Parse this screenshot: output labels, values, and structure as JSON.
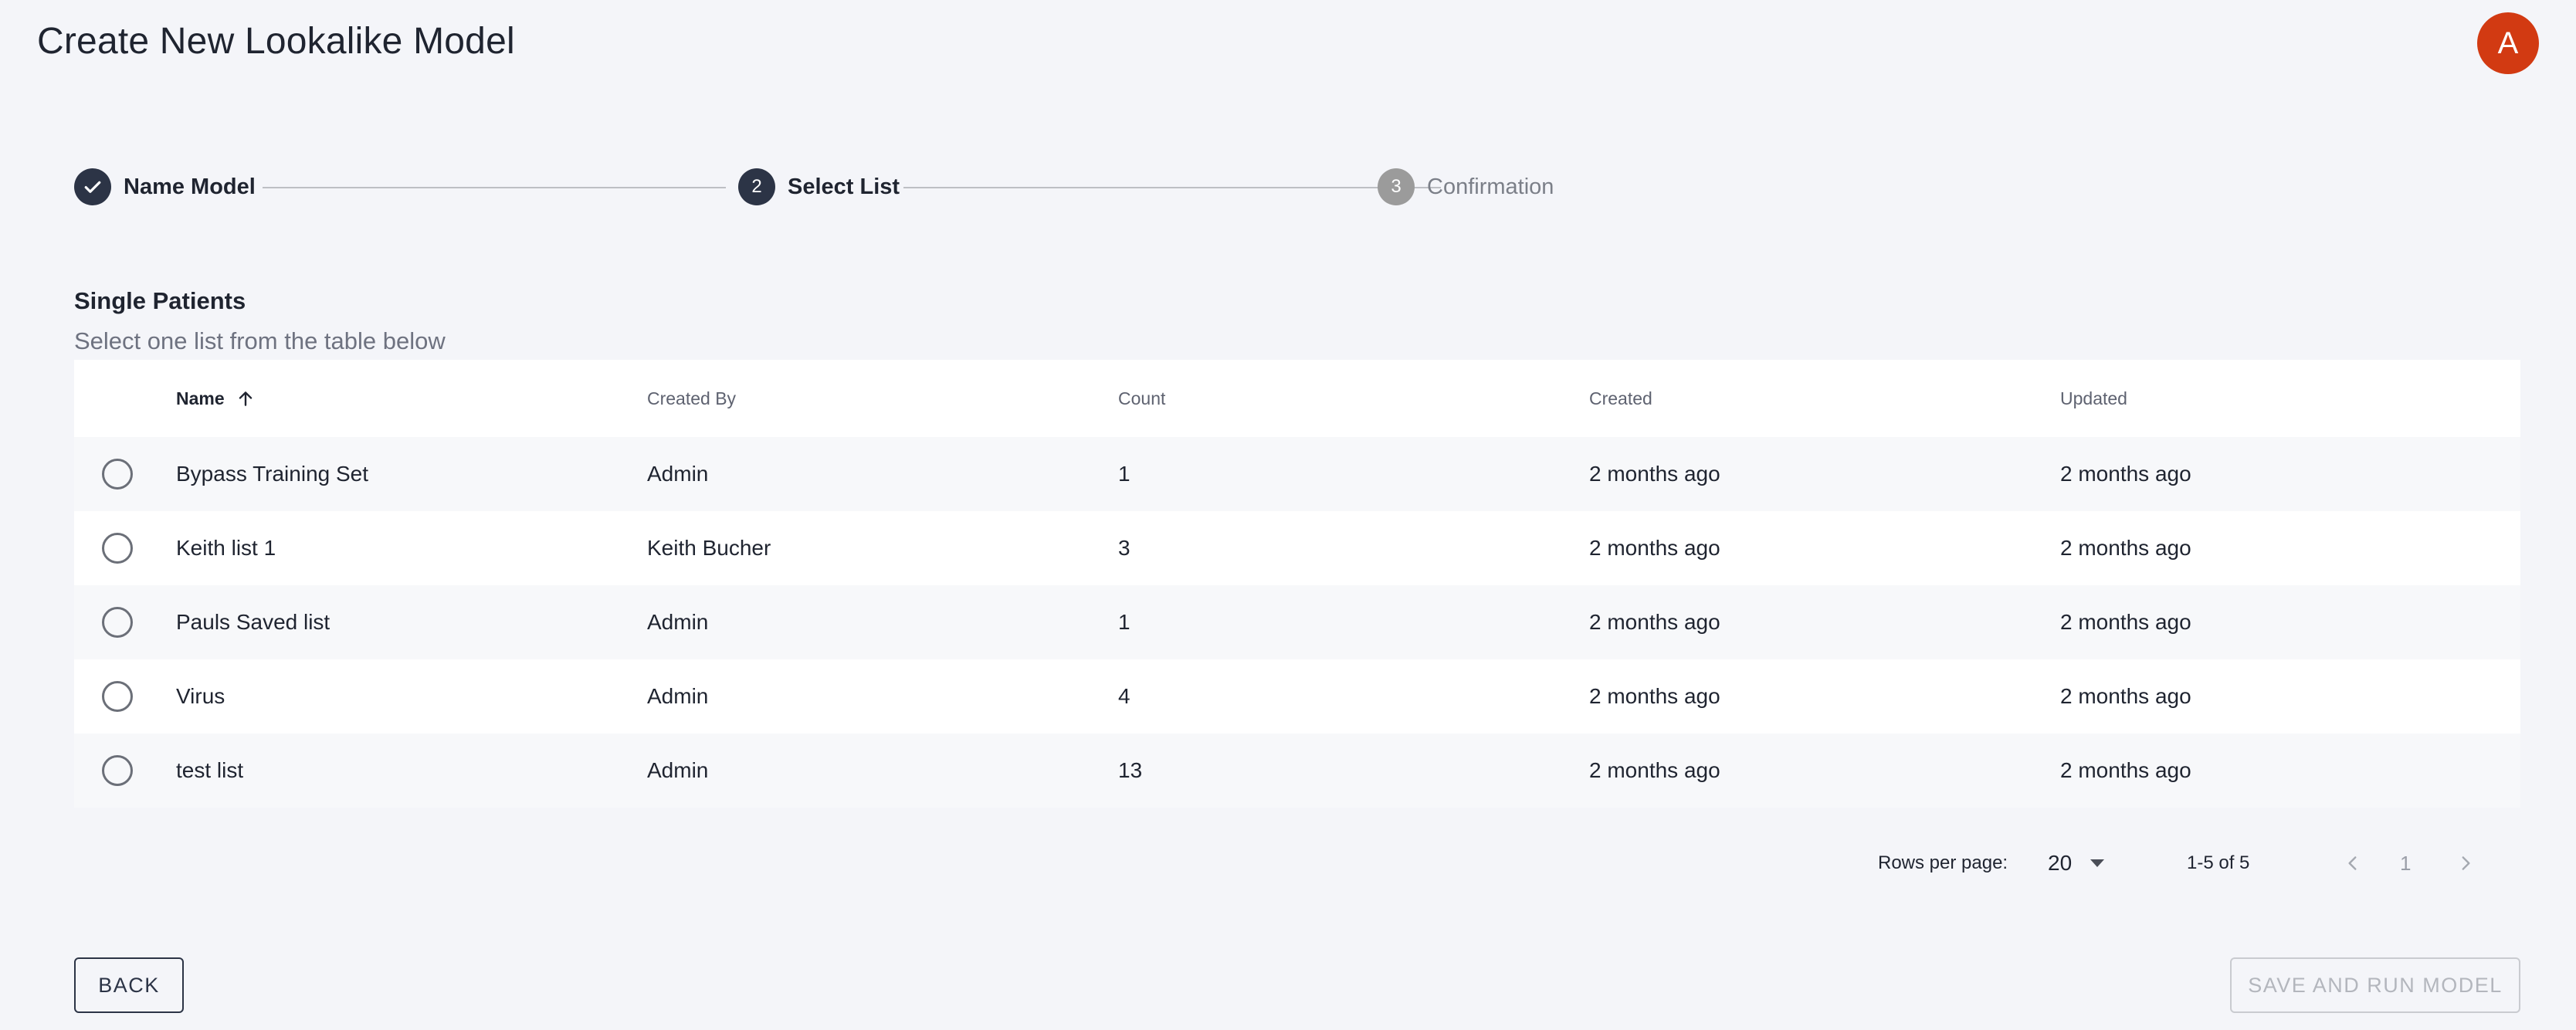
{
  "header": {
    "title": "Create New Lookalike Model",
    "avatar_letter": "A",
    "avatar_color": "#d23a12"
  },
  "stepper": {
    "steps": [
      {
        "number": "1",
        "label": "Name Model",
        "state": "completed",
        "icon": "check-icon"
      },
      {
        "number": "2",
        "label": "Select List",
        "state": "active"
      },
      {
        "number": "3",
        "label": "Confirmation",
        "state": "pending"
      }
    ]
  },
  "section": {
    "title": "Single Patients",
    "subtitle": "Select one list from the table below"
  },
  "table": {
    "columns": [
      "Name",
      "Created By",
      "Count",
      "Created",
      "Updated"
    ],
    "sort": {
      "column": "Name",
      "direction": "asc",
      "icon": "arrow-up-icon"
    },
    "rows": [
      {
        "name": "Bypass Training Set",
        "created_by": "Admin",
        "count": "1",
        "created": "2 months ago",
        "updated": "2 months ago"
      },
      {
        "name": "Keith list 1",
        "created_by": "Keith Bucher",
        "count": "3",
        "created": "2 months ago",
        "updated": "2 months ago"
      },
      {
        "name": "Pauls Saved list",
        "created_by": "Admin",
        "count": "1",
        "created": "2 months ago",
        "updated": "2 months ago"
      },
      {
        "name": "Virus",
        "created_by": "Admin",
        "count": "4",
        "created": "2 months ago",
        "updated": "2 months ago"
      },
      {
        "name": "test list",
        "created_by": "Admin",
        "count": "13",
        "created": "2 months ago",
        "updated": "2 months ago"
      }
    ]
  },
  "pagination": {
    "rows_per_page_label": "Rows per page:",
    "rows_per_page": "20",
    "range": "1-5 of 5",
    "page": "1"
  },
  "actions": {
    "back_label": "BACK",
    "save_label": "SAVE AND RUN MODEL",
    "save_disabled": true
  },
  "colors": {
    "background": "#f4f5f9",
    "primary_dark": "#2c3446",
    "pending_gray": "#9b9b9b"
  }
}
